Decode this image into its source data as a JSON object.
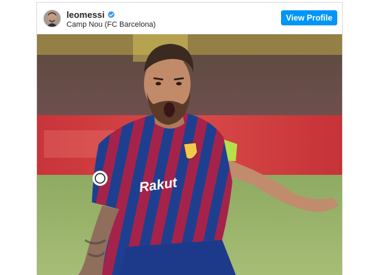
{
  "post": {
    "username": "leomessi",
    "verified": true,
    "location": "Camp Nou (FC Barcelona)",
    "view_profile_label": "View Profile",
    "photo": {
      "description_icon": "photo-image",
      "jersey_text": "Rakuten"
    }
  },
  "colors": {
    "accent": "#0095f6",
    "verified_badge": "#3897f0"
  }
}
